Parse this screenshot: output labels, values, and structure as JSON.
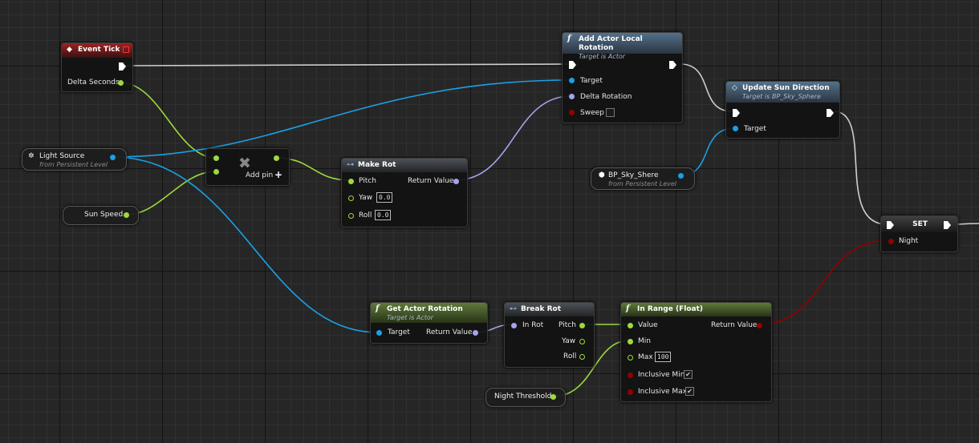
{
  "nodes": {
    "event_tick": {
      "title": "Event Tick",
      "delta_seconds": "Delta Seconds"
    },
    "add_local_rotation": {
      "title": "Add Actor Local Rotation",
      "subtitle": "Target is Actor",
      "target": "Target",
      "delta_rotation": "Delta Rotation",
      "sweep": "Sweep"
    },
    "update_sun": {
      "title": "Update Sun Direction",
      "subtitle": "Target is BP_Sky_Sphere",
      "target": "Target"
    },
    "light_source": {
      "name": "Light Source",
      "sub": "from Persistent Level"
    },
    "sun_speed": {
      "name": "Sun Speed"
    },
    "multiply": {
      "add_pin": "Add pin",
      "symbol": "✖",
      "plus": "+"
    },
    "make_rot": {
      "title": "Make Rot",
      "pitch": "Pitch",
      "yaw": "Yaw",
      "roll": "Roll",
      "yaw_value": "0.0",
      "roll_value": "0.0",
      "return_value": "Return Value"
    },
    "sky_sphere": {
      "name": "BP_Sky_Shere",
      "sub": "from Persistent Level"
    },
    "set_node": {
      "title": "SET",
      "night": "Night"
    },
    "get_actor_rotation": {
      "title": "Get Actor Rotation",
      "subtitle": "Target is Actor",
      "target": "Target",
      "return_value": "Return Value"
    },
    "break_rot": {
      "title": "Break Rot",
      "in_rot": "In Rot",
      "pitch": "Pitch",
      "yaw": "Yaw",
      "roll": "Roll"
    },
    "in_range": {
      "title": "In Range (Float)",
      "value": "Value",
      "min": "Min",
      "max": "Max",
      "max_value": "100",
      "inclusive_min": "Inclusive Min",
      "inclusive_max": "Inclusive Max",
      "return_value": "Return Value",
      "check": "✔"
    },
    "night_threshold": {
      "name": "Night Threshold"
    }
  },
  "colors": {
    "exec": "#ffffff",
    "float": "#9dd93f",
    "object": "#1aa0e6",
    "rotator": "#a3a3ef",
    "bool": "#930000"
  }
}
